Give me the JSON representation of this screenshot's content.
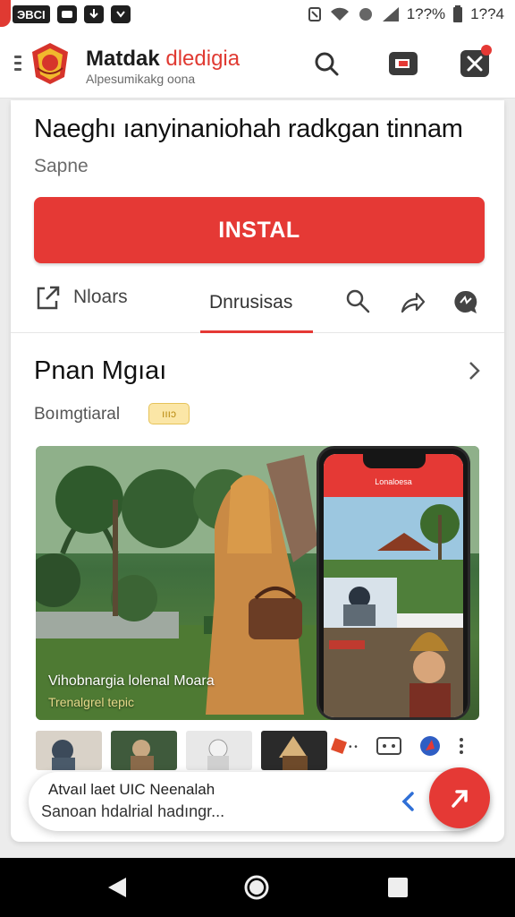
{
  "status_bar": {
    "left_chip": "ЭBCI",
    "battery": "1??%",
    "time": "1??4"
  },
  "app_bar": {
    "title_main": "Matdak",
    "title_accent": "dledigia",
    "subtitle": "Alpesumikakg oona"
  },
  "main": {
    "headline": "Naeghı ıanyinaniohah radkgan tinnam",
    "sub_label": "Sapne",
    "install_label": "INSTAL",
    "actions": {
      "news_label": "Nloars",
      "discussion_label": "Dnrusisas"
    },
    "section": {
      "title": "Pnan Mgıaı",
      "subtitle": "Boımgtiaral",
      "badge": "ıııɔ"
    },
    "media": {
      "caption": "Vihobnargia lolenal Moara",
      "subcaption": "Trenalgrel tepic",
      "phone_title": "Lonaloesa"
    }
  },
  "toast": {
    "line1": "Atvaıl laet UIC Neenalah",
    "line2": "Sanoan hdalrial hadıngr..."
  },
  "colors": {
    "accent": "#e53935",
    "app_bar": "#ffffff",
    "background": "#ececec",
    "nav_bar": "#000000"
  }
}
